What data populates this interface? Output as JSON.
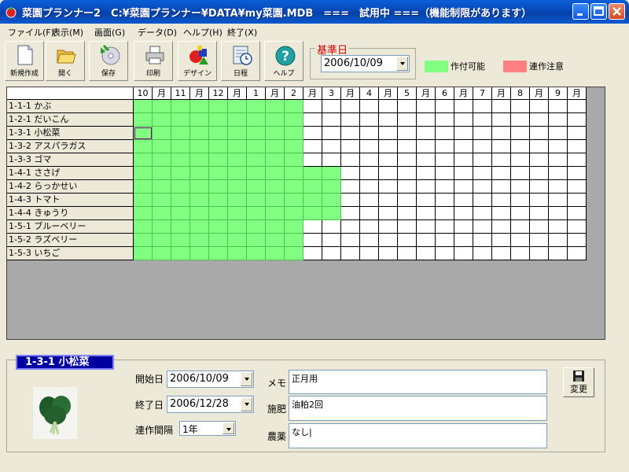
{
  "window": {
    "title": "菜園プランナー2　C:¥菜園プランナー¥DATA¥my菜園.MDB　===　試用中 ===（機能制限があります）"
  },
  "menu": [
    {
      "label": "ファイル(F)"
    },
    {
      "label": "表示(M)"
    },
    {
      "label": "画面(G)"
    },
    {
      "label": "データ(D)"
    },
    {
      "label": "ヘルプ(H)"
    },
    {
      "label": "終了(X)"
    }
  ],
  "toolbar": [
    {
      "label": "新規作成",
      "icon": "new-document-icon"
    },
    {
      "label": "開く",
      "icon": "open-folder-icon"
    },
    {
      "label": "保存",
      "icon": "save-disc-icon"
    },
    {
      "label": "印刷",
      "icon": "printer-icon"
    },
    {
      "label": "デザイン",
      "icon": "shapes-icon"
    },
    {
      "label": "日程",
      "icon": "schedule-clock-icon"
    },
    {
      "label": "ヘルプ",
      "icon": "help-icon"
    }
  ],
  "base_date": {
    "label": "基準日",
    "value": "2006/10/09"
  },
  "legend": [
    {
      "label": "作付可能",
      "color": "#80ff80"
    },
    {
      "label": "連作注意",
      "color": "#ff8080"
    }
  ],
  "grid": {
    "header": [
      "10",
      "月",
      "11",
      "月",
      "12",
      "月",
      "1",
      "月",
      "2",
      "月",
      "3",
      "月",
      "4",
      "月",
      "5",
      "月",
      "6",
      "月",
      "7",
      "月",
      "8",
      "月",
      "9",
      "月"
    ],
    "rows": [
      {
        "label": "1-1-1 かぶ",
        "green_cols": 9
      },
      {
        "label": "1-2-1 だいこん",
        "green_cols": 9
      },
      {
        "label": "1-3-1 小松菜",
        "green_cols": 9,
        "selected_col": 0
      },
      {
        "label": "1-3-2 アスパラガス",
        "green_cols": 9
      },
      {
        "label": "1-3-3 ゴマ",
        "green_cols": 9
      },
      {
        "label": "1-4-1 ささげ",
        "green_cols": 11
      },
      {
        "label": "1-4-2 らっかせい",
        "green_cols": 11
      },
      {
        "label": "1-4-3 トマト",
        "green_cols": 11
      },
      {
        "label": "1-4-4 きゅうり",
        "green_cols": 11
      },
      {
        "label": "1-5-1 ブルーベリー",
        "green_cols": 9
      },
      {
        "label": "1-5-2 ラズベリー",
        "green_cols": 9
      },
      {
        "label": "1-5-3 いちご",
        "green_cols": 9
      }
    ]
  },
  "detail": {
    "title": "1-3-1 小松菜",
    "start_label": "開始日",
    "start_value": "2006/10/09",
    "end_label": "終了日",
    "end_value": "2006/12/28",
    "interval_label": "連作間隔",
    "interval_value": "1年",
    "memo_label": "メモ",
    "memo_value": "正月用",
    "fertilizer_label": "施肥",
    "fertilizer_value": "油粕2回",
    "pesticide_label": "農薬",
    "pesticide_value": "なし|",
    "change_label": "変更"
  }
}
